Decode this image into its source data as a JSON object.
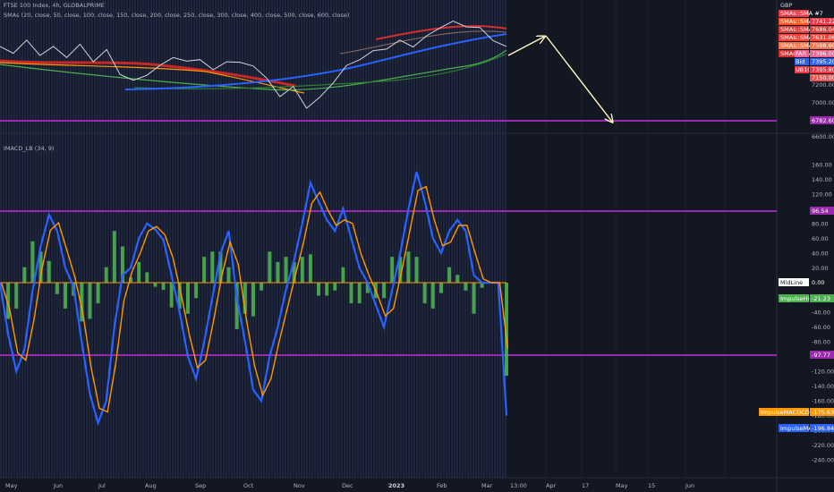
{
  "title": "FTSE 100 Index, 4h, GLOBALPRIME",
  "sma_legend": "SMAs (20, close, 50, close, 100, close, 150, close, 200, close, 250, close, 300, close, 400, close, 500, close, 600, close)",
  "price_badges": [
    {
      "text": "GBP",
      "bg": "#131722",
      "fg": "#d1d4dc"
    },
    {
      "text": "SMAs::SMA #7",
      "bg": "#f23645",
      "fg": "#ffffff"
    },
    {
      "text": "SMAs::SMA #7",
      "bg": "#ff5722",
      "fg": "#ffffff"
    },
    {
      "text": "SMAs::SMA #6",
      "bg": "#e53935",
      "fg": "#ffffff"
    },
    {
      "text": "SMAs::SMA #5",
      "bg": "#f44336",
      "fg": "#ffffff"
    },
    {
      "text": "SMAs::SMA #1",
      "bg": "#ff7043",
      "fg": "#ffffff"
    },
    {
      "text": "SMAs::SMA #10",
      "bg": "#d32f2f",
      "fg": "#ffffff"
    },
    {
      "text": "FAR",
      "bg": "#f06292",
      "fg": "#ffffff"
    },
    {
      "text": "Bid",
      "bg": "#2962ff",
      "fg": "#ffffff"
    },
    {
      "text": "UB100",
      "bg": "#f23645",
      "fg": "#ffffff"
    }
  ],
  "price_values": [
    "7741.22",
    "7686.04",
    "7631.06",
    "7598.60",
    "7396.00",
    "7395.20",
    "7395.80",
    "7150.00"
  ],
  "price_axis_ticks": [
    "7200.00",
    "7000.00",
    "6600.00"
  ],
  "price_level_label": "6782.60",
  "macd_title": "IMACD_LB (34, 9)",
  "macd_axis_ticks": [
    "160.00",
    "140.00",
    "120.00",
    "100.00",
    "80.00",
    "60.00",
    "40.00",
    "20.00",
    "0.00",
    "-20.00",
    "-40.00",
    "-60.00",
    "-80.00",
    "-100.00",
    "-120.00",
    "-140.00",
    "-160.00",
    "-180.00",
    "-200.00",
    "-220.00",
    "-240.00",
    "-260.00"
  ],
  "macd_level_labels": {
    "upper": "96.54",
    "midline_name": "MidLine",
    "midline_val": "0.00",
    "lower": "-97.77"
  },
  "indicator_labels": [
    {
      "name": "ImpulseHisto",
      "value": "-21.23",
      "color": "#4caf50"
    },
    {
      "name": "ImpulseMACDCDSignal",
      "value": "-175.63",
      "color": "#ff9800"
    },
    {
      "name": "ImpulseMACD",
      "value": "-196.84",
      "color": "#2962ff"
    }
  ],
  "time_labels": [
    "May",
    "Jun",
    "Jul",
    "Aug",
    "Sep",
    "Oct",
    "Nov",
    "Dec",
    "2023",
    "Feb",
    "Mar",
    "13:00",
    "Apr",
    "17",
    "May",
    "15",
    "Jun"
  ],
  "colors": {
    "purple": "#9c27b0",
    "orange": "#ff9800",
    "blue": "#2962ff",
    "green": "#4caf50",
    "arrow": "#fff9c4"
  },
  "chart_data": {
    "type": "line",
    "panes": [
      {
        "name": "FTSE 100 Index, 4h, GLOBALPRIME",
        "y_range_approx": [
          6700,
          7950
        ],
        "horizontal_level": 6782.6,
        "price_path_normalized_0_to_1_top": [
          0.3,
          0.34,
          0.24,
          0.36,
          0.3,
          0.38,
          0.28,
          0.42,
          0.33,
          0.54,
          0.62,
          0.55,
          0.48,
          0.38,
          0.44,
          0.4,
          0.52,
          0.42,
          0.45,
          0.46,
          0.6,
          0.75,
          0.68,
          0.86,
          0.78,
          0.62,
          0.48,
          0.4,
          0.34,
          0.3,
          0.24,
          0.28,
          0.2,
          0.1,
          0.06,
          0.09,
          0.12,
          0.22,
          0.3
        ],
        "forecast_arrow": "up to Apr, then down toward 6782.60 in May"
      },
      {
        "name": "IMACD_LB (34, 9)",
        "y_range": [
          -260,
          160
        ],
        "levels": {
          "upper": 96.54,
          "mid": 0,
          "lower": -97.77
        },
        "macd_path": [
          0,
          -70,
          -120,
          -90,
          -10,
          50,
          92,
          70,
          20,
          -5,
          -80,
          -150,
          -190,
          -160,
          -60,
          10,
          20,
          60,
          80,
          72,
          58,
          10,
          -40,
          -100,
          -130,
          -80,
          -20,
          40,
          70,
          -20,
          -80,
          -145,
          -160,
          -100,
          -60,
          -10,
          30,
          80,
          135,
          110,
          85,
          70,
          100,
          60,
          20,
          0,
          -30,
          -60,
          -10,
          40,
          100,
          150,
          110,
          60,
          40,
          70,
          85,
          70,
          10,
          0,
          0,
          0,
          -180
        ],
        "final_values": {
          "histogram": -21.23,
          "signal": -175.63,
          "macd": -196.84
        }
      }
    ]
  }
}
